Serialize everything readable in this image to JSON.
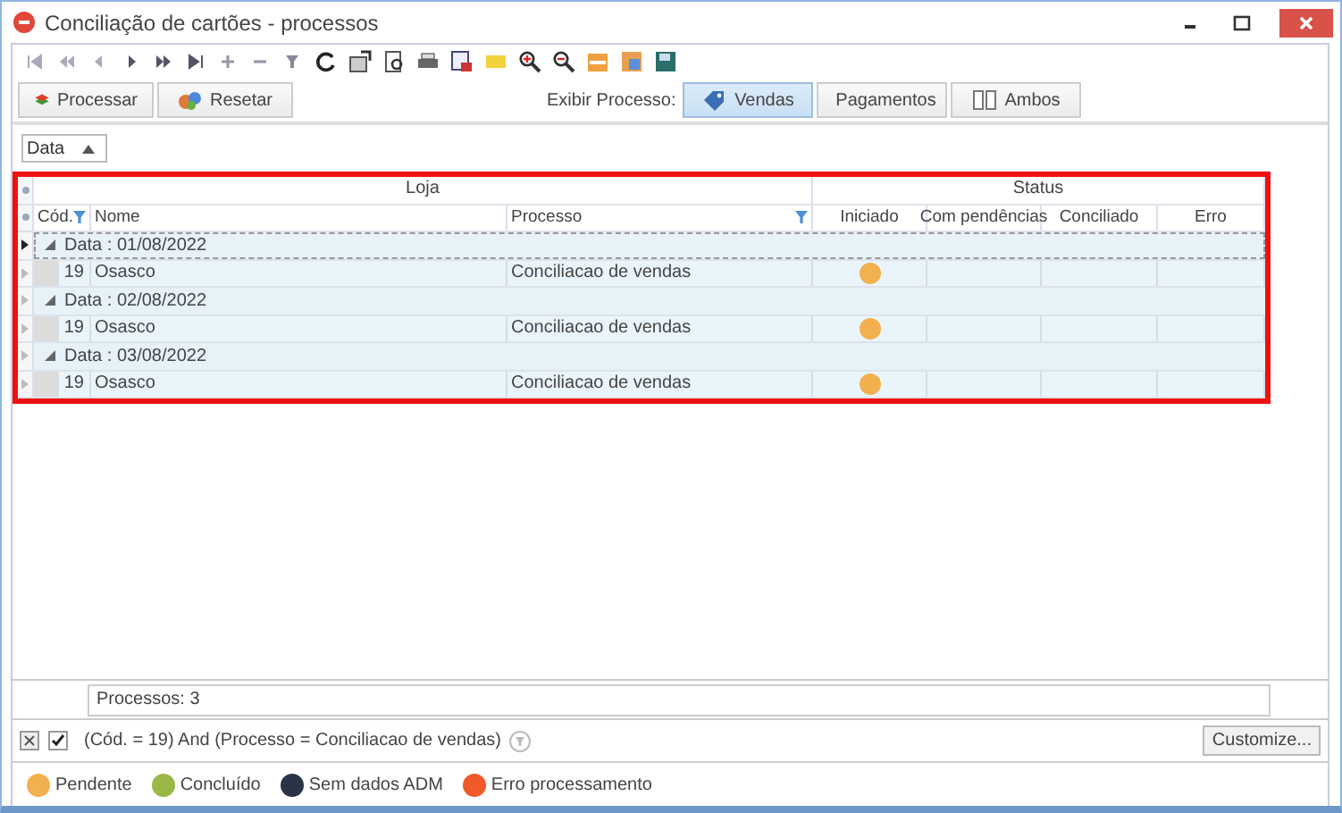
{
  "window": {
    "title": "Conciliação de cartões - processos"
  },
  "actions": [
    {
      "label": "Processar",
      "kind": "process"
    },
    {
      "label": "Resetar",
      "kind": "reset"
    }
  ],
  "view_label": "Exibir Processo:",
  "view_options": [
    {
      "label": "Vendas",
      "selected": true,
      "kind": "sales"
    },
    {
      "label": "Pagamentos",
      "selected": false,
      "kind": "payments"
    },
    {
      "label": "Ambos",
      "selected": false,
      "kind": "both"
    }
  ],
  "group_panel": {
    "field": "Data"
  },
  "grid": {
    "bands": [
      {
        "label": "Loja"
      },
      {
        "label": "Status"
      }
    ],
    "columns": [
      {
        "label": "Cód.",
        "filtered": true
      },
      {
        "label": "Nome",
        "filtered": false
      },
      {
        "label": "Processo",
        "filtered": true
      },
      {
        "label": "Iniciado",
        "filtered": false
      },
      {
        "label": "Com pendências",
        "filtered": false
      },
      {
        "label": "Conciliado",
        "filtered": false
      },
      {
        "label": "Erro",
        "filtered": false
      }
    ],
    "groups": [
      {
        "label": "Data : 01/08/2022",
        "expanded": true,
        "focused": true,
        "rows": [
          {
            "cod": "19",
            "nome": "Osasco",
            "processo": "Conciliacao de vendas",
            "status": [
              {
                "dot": true
              },
              {
                "dot": false
              },
              {
                "dot": false
              },
              {
                "dot": false
              }
            ],
            "color": "#f2b04e"
          }
        ]
      },
      {
        "label": "Data : 02/08/2022",
        "expanded": true,
        "focused": false,
        "rows": [
          {
            "cod": "19",
            "nome": "Osasco",
            "processo": "Conciliacao de vendas",
            "status": [
              {
                "dot": true
              },
              {
                "dot": false
              },
              {
                "dot": false
              },
              {
                "dot": false
              }
            ],
            "color": "#f2b04e"
          }
        ]
      },
      {
        "label": "Data : 03/08/2022",
        "expanded": true,
        "focused": false,
        "rows": [
          {
            "cod": "19",
            "nome": "Osasco",
            "processo": "Conciliacao de vendas",
            "status": [
              {
                "dot": true
              },
              {
                "dot": false
              },
              {
                "dot": false
              },
              {
                "dot": false
              }
            ],
            "color": "#f2b04e"
          }
        ]
      }
    ]
  },
  "footer": {
    "summary": "Processos: 3"
  },
  "filter_bar": {
    "enabled": true,
    "expression": "(Cód. = 19) And (Processo  = Conciliacao de vendas)",
    "customize": "Customize..."
  },
  "legend": [
    {
      "label": "Pendente",
      "color": "#f2b04e"
    },
    {
      "label": "Concluído",
      "color": "#9ab845"
    },
    {
      "label": "Sem dados ADM",
      "color": "#2a3446"
    },
    {
      "label": "Erro processamento",
      "color": "#f05a28"
    }
  ]
}
